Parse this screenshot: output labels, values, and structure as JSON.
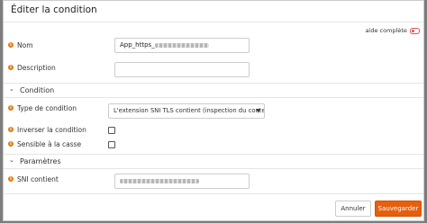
{
  "dialog": {
    "title": "Éditer la condition",
    "help_toggle_label": "aide complète"
  },
  "fields": {
    "nom": {
      "label": "Nom",
      "value": "App_https_"
    },
    "description": {
      "label": "Description",
      "value": ""
    }
  },
  "sections": {
    "condition": "Condition",
    "parametres": "Paramètres"
  },
  "condition": {
    "type_label": "Type de condition",
    "type_value": "L'extension SNI TLS contient (inspection du conten",
    "inverser_label": "Inverser la condition",
    "inverser_checked": false,
    "casse_label": "Sensible à la casse",
    "casse_checked": false
  },
  "parametres": {
    "sni_label": "SNI contient",
    "sni_value": ""
  },
  "footer": {
    "cancel_label": "Annuler",
    "save_label": "Sauvegarder"
  },
  "colors": {
    "accent": "#e4600e",
    "info_icon": "#e07b10",
    "toggle": "#d9534f"
  },
  "icons": {
    "info": "info-icon",
    "section_toggle": "chevron-down-icon",
    "select_caret": "caret-down-icon",
    "help": "toggle-off-icon"
  }
}
